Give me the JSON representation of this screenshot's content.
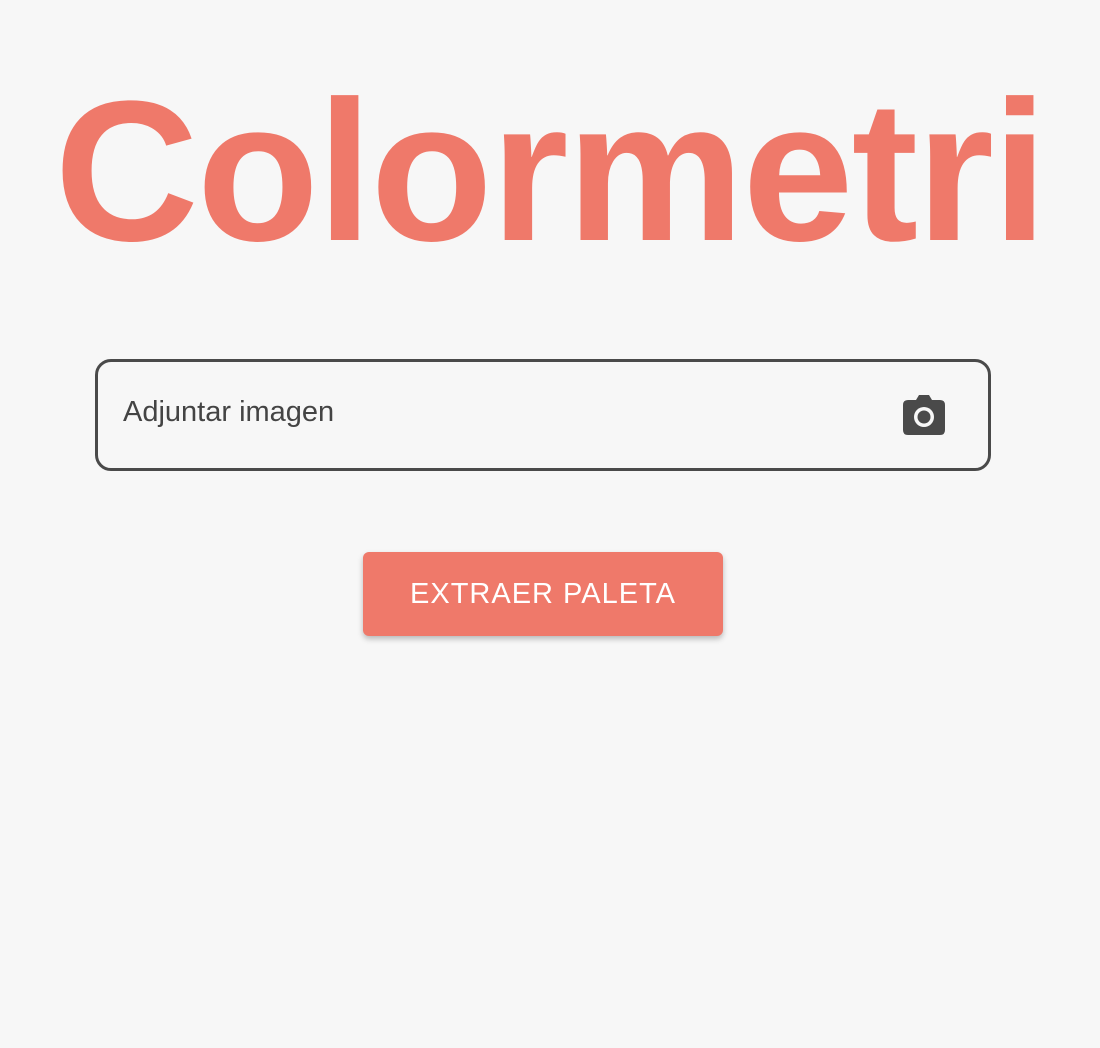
{
  "app": {
    "title": "Colormetri"
  },
  "upload": {
    "label": "Adjuntar imagen",
    "icon": "camera-icon"
  },
  "actions": {
    "extract_label": "EXTRAER PALETA"
  },
  "colors": {
    "accent": "#ef796a",
    "background": "#f7f7f7",
    "border": "#4a4a4a",
    "text": "#444444"
  }
}
